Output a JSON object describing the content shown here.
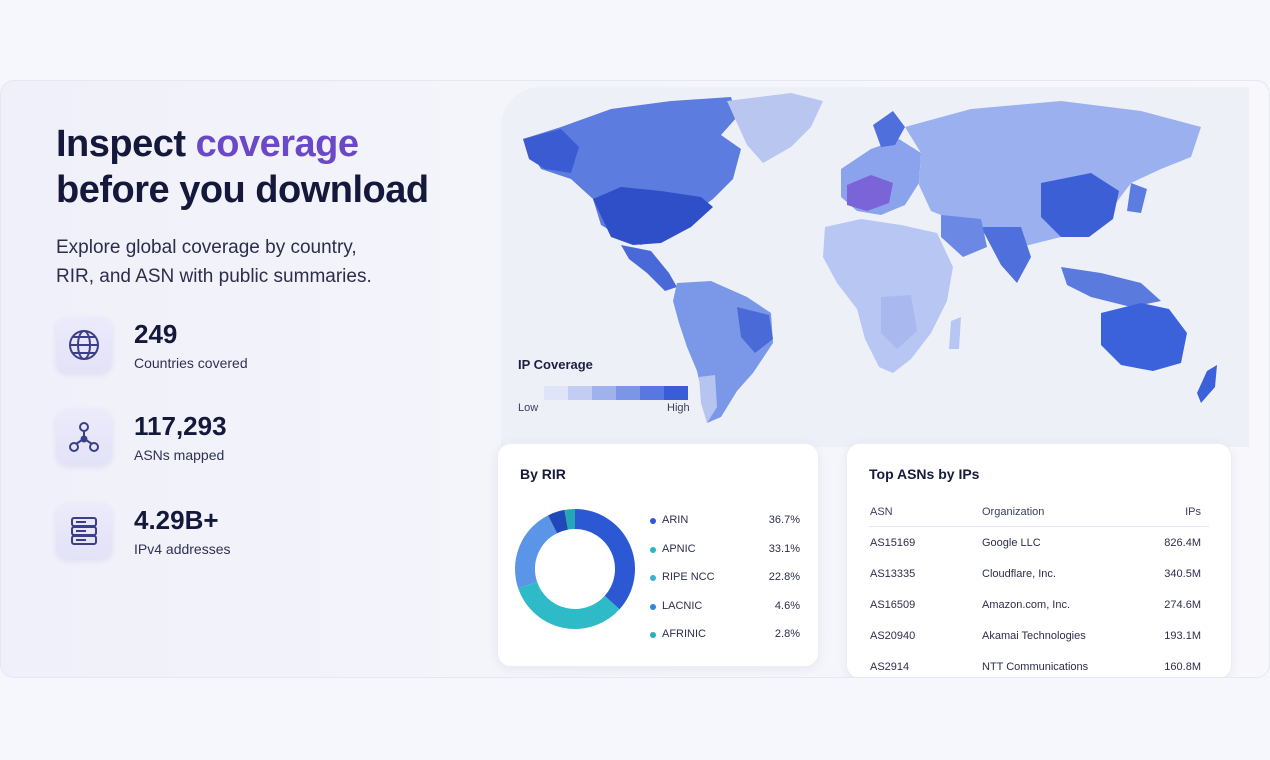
{
  "hero": {
    "title_part1": "Inspect ",
    "title_accent": "coverage",
    "title_part2": "before you download",
    "subtitle_line1": "Explore global coverage by country,",
    "subtitle_line2": "RIR, and ASN with public summaries."
  },
  "stats": [
    {
      "value": "249",
      "label": "Countries covered",
      "icon": "globe-icon"
    },
    {
      "value": "117,293",
      "label": "ASNs mapped",
      "icon": "network-icon"
    },
    {
      "value": "4.29B+",
      "label": "IPv4 addresses",
      "icon": "server-icon"
    }
  ],
  "map": {
    "legend_title": "IP Coverage",
    "low_label": "Low",
    "high_label": "High",
    "scale_colors": [
      "#dfe4f8",
      "#c3cdf3",
      "#9fb2ee",
      "#7b95e8",
      "#5878e0",
      "#3a5dd6"
    ]
  },
  "rir": {
    "title": "By RIR",
    "items": [
      {
        "name": "ARIN",
        "pct": "36.7%",
        "value": 36.7,
        "color": "#2d58d4"
      },
      {
        "name": "APNIC",
        "pct": "33.1%",
        "value": 33.1,
        "color": "#28b6c4"
      },
      {
        "name": "RIPE NCC",
        "pct": "22.8%",
        "value": 22.8,
        "color": "#3bb0d0"
      },
      {
        "name": "LACNIC",
        "pct": "4.6%",
        "value": 4.6,
        "color": "#2f87d6"
      },
      {
        "name": "AFRINIC",
        "pct": "2.8%",
        "value": 2.8,
        "color": "#2ab0b8"
      }
    ],
    "ring_colors": [
      "#2d58d4",
      "#2fbac7",
      "#5b95e8",
      "#1f49b8",
      "#26a7b6"
    ]
  },
  "asns": {
    "title": "Top ASNs by IPs",
    "columns": [
      "ASN",
      "Organization",
      "IPs"
    ],
    "rows": [
      [
        "AS15169",
        "Google LLC",
        "826.4M"
      ],
      [
        "AS13335",
        "Cloudflare, Inc.",
        "340.5M"
      ],
      [
        "AS16509",
        "Amazon.com, Inc.",
        "274.6M"
      ],
      [
        "AS20940",
        "Akamai Technologies",
        "193.1M"
      ],
      [
        "AS2914",
        "NTT Communications",
        "160.8M"
      ]
    ]
  }
}
